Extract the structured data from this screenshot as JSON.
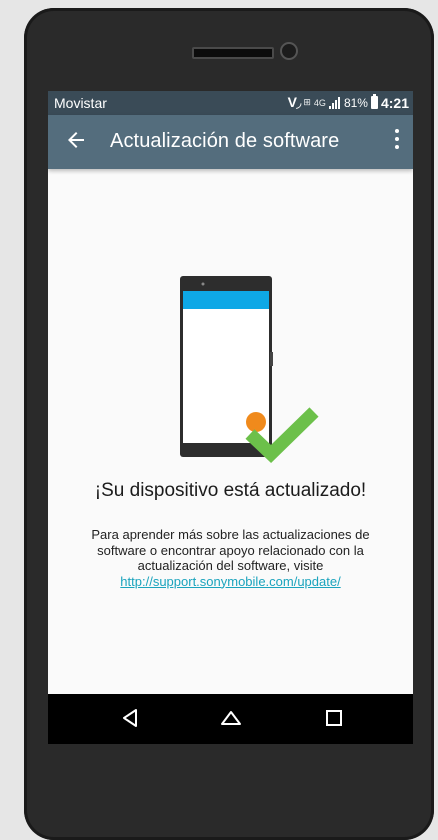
{
  "status_bar": {
    "carrier": "Movistar",
    "volte_label": "V",
    "network_type": "4G",
    "battery_percent": "81%",
    "time": "4:21"
  },
  "app_bar": {
    "title": "Actualización de software",
    "back_icon": "arrow-back-icon",
    "menu_icon": "more-vert-icon"
  },
  "content": {
    "headline": "¡Su dispositivo está actualizado!",
    "body": "Para aprender más sobre las actualizaciones de software o encontrar apoyo relacionado con la actualización del software, visite",
    "link_text": "http://support.sonymobile.com/update/",
    "illustration_icon": "phone-updated-checkmark-icon",
    "accent_color": "#0ea8e6",
    "dot_color": "#f08a1c",
    "check_color": "#6cc04a"
  },
  "nav_bar": {
    "back_icon": "triangle-back-icon",
    "home_icon": "home-icon",
    "recents_icon": "square-recents-icon"
  },
  "colors": {
    "status_bar": "#3a4b57",
    "app_bar": "#546d7d",
    "link": "#1ba4bd"
  }
}
